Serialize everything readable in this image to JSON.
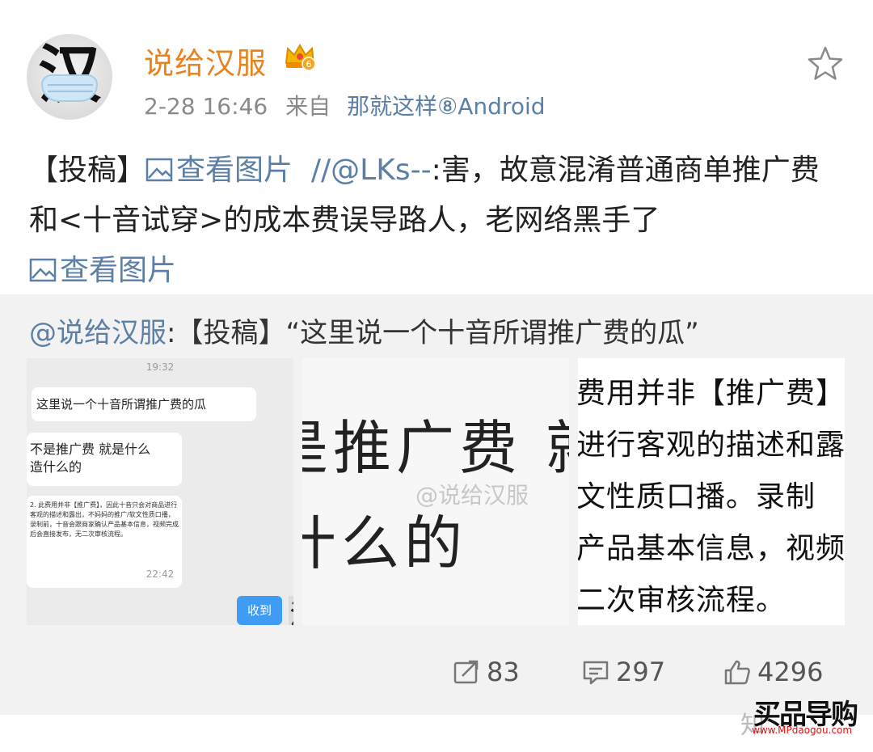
{
  "post": {
    "username": "说给汉服",
    "avatar_char": "汉",
    "vip_level": "6",
    "timestamp": "2-28 16:46",
    "source_prefix": "来自",
    "source_name": "那就这样⑧Android",
    "content_tag": "【投稿】",
    "view_images_label": "查看图片",
    "repost_user": "//@LKs--",
    "content_text": ":害，故意混淆普通商单推广费和<十音试穿>的成本费误导路人，老网络黑手了"
  },
  "repost": {
    "at_user": "@说给汉服",
    "text": ":【投稿】“这里说一个十音所谓推广费的瓜”"
  },
  "images": {
    "thumb1": {
      "time_top": "19:32",
      "bubble1": "这里说一个十音所谓推广费的瓜",
      "bubble2_line1": "不是推广费 就是什么",
      "bubble2_line2": "造什么的",
      "bubble3": "2. 此费用并非【推广费】，因此十音只会对商品进行客观的描述和露出，不妈妈的推广/软文性质口播，录制前，十音会跟商家确认产品基本信息，视频完成后会直接发布，无二次审核流程。",
      "time_bottom": "22:42",
      "received_label": "收到"
    },
    "thumb2": {
      "line1": "是推广费 就",
      "line2": "什么的",
      "watermark": "@说给汉服"
    },
    "thumb3": {
      "line1": "费用并非【推广费】",
      "line2": "进行客观的描述和露",
      "line3": "文性质口播。录制",
      "line4": "产品基本信息，视频",
      "line5": "二次审核流程。"
    }
  },
  "actions": {
    "repost_count": "83",
    "comment_count": "297",
    "like_count": "4296"
  },
  "brand": {
    "name": "买品导购",
    "url": "www.MPdaogou.com",
    "zhihu_mark": "知"
  },
  "colors": {
    "username": "#e8821e",
    "link": "#5b7fa6",
    "received_button": "#3f9cf5"
  }
}
